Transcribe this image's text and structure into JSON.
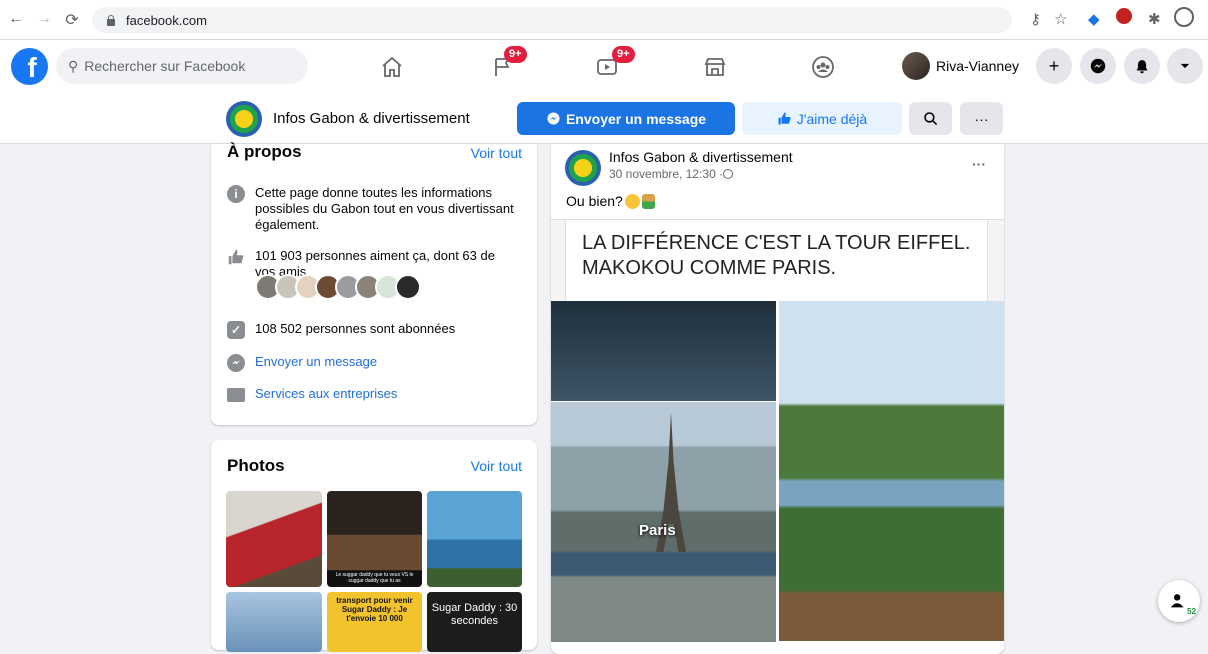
{
  "browser": {
    "url": "facebook.com",
    "back_icon": "arrow-left-icon",
    "forward_icon": "arrow-right-icon",
    "reload_icon": "reload-icon"
  },
  "header": {
    "search_placeholder": "Rechercher sur Facebook",
    "notifications": {
      "pages": "9+",
      "watch": "9+"
    },
    "profile_name": "Riva-Vianney"
  },
  "page": {
    "name": "Infos Gabon & divertissement",
    "send_message": "Envoyer un message",
    "like_label": "J'aime déjà",
    "more_label": "···"
  },
  "about": {
    "title": "À propos",
    "see_all": "Voir tout",
    "description": "Cette page donne toutes les informations possibles du Gabon tout en vous divertissant également.",
    "likes": "101 903 personnes aiment ça, dont 63 de vos amis",
    "followers": "108 502 personnes sont abonnées",
    "message_link": "Envoyer un message",
    "services_link": "Services aux entreprises"
  },
  "photos": {
    "title": "Photos",
    "see_all": "Voir tout",
    "captions": {
      "p2": "Le suggar daddy que tu veux VS le suggar daddy que tu as",
      "p5": "transport pour venir Sugar Daddy : Je t'envoie 10 000",
      "p6": "Sugar Daddy : 30 secondes"
    }
  },
  "post": {
    "author": "Infos Gabon & divertissement",
    "meta": "30 novembre, 12:30 · ",
    "text": "Ou bien?",
    "menu": "···",
    "image_caption": "LA DIFFÉRENCE C'EST LA TOUR EIFFEL. MAKOKOU COMME PARIS.",
    "image_label": "Paris"
  },
  "contacts_badge": "52",
  "colors": {
    "brand": "#1877f2",
    "badge": "#e41e3f",
    "bg": "#f0f2f5"
  }
}
